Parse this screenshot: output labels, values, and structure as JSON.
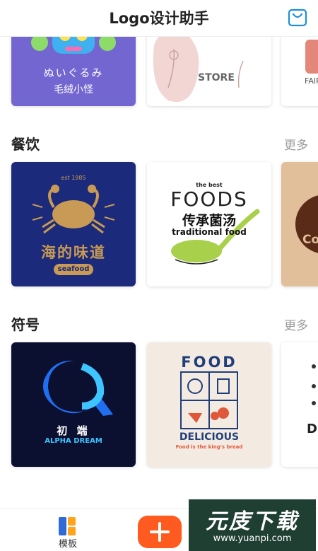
{
  "app": {
    "title": "Logo设计助手"
  },
  "row_top": {
    "card1": {
      "text_jp": "ぬいぐるみ",
      "text_cn": "毛绒小怪"
    },
    "card2": {
      "text": "STORE"
    },
    "card3": {
      "text": "FAIR"
    }
  },
  "sections": [
    {
      "title": "餐饮",
      "more": "更多",
      "cards": [
        {
          "small_text": "est 1985",
          "name": "海的味道",
          "badge": "seafood"
        },
        {
          "small_text": "the best",
          "big": "FOODS",
          "cn": "传承菌汤",
          "en": "traditional food"
        },
        {
          "partial": "Co"
        }
      ]
    },
    {
      "title": "符号",
      "more": "更多",
      "cards": [
        {
          "cn": "初 端",
          "en": "ALPHA DREAM"
        },
        {
          "top": "FOOD",
          "bottom": "DELICIOUS",
          "tagline": "Food is the king's bread"
        },
        {
          "partial": "D"
        }
      ]
    }
  ],
  "bottom_nav": {
    "templates_label": "模板"
  },
  "watermark": {
    "title": "元庋下载",
    "url": "www.yuanpi.com"
  },
  "colors": {
    "accent": "#ff5a1f",
    "purple": "#7466d0",
    "navy": "#1b2a7a",
    "gold": "#c89a55",
    "cream": "#f3ebe2",
    "dark": "#0c1030"
  }
}
